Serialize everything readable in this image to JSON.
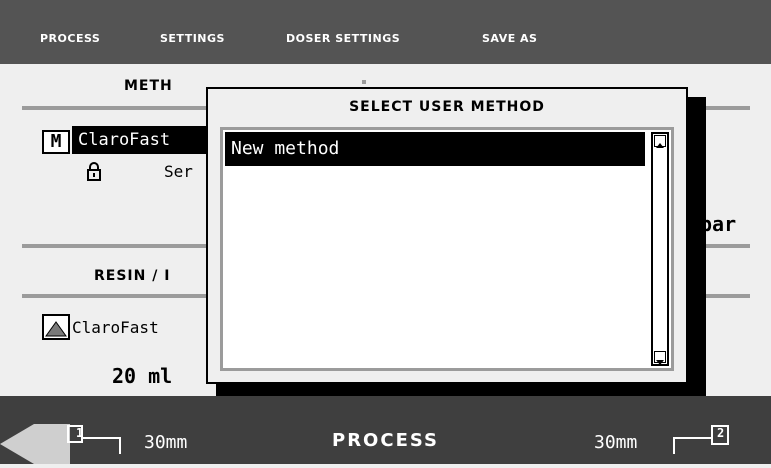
{
  "menu": {
    "process": "PROCESS",
    "settings": "SETTINGS",
    "doser_settings": "DOSER SETTINGS",
    "save_as": "SAVE AS"
  },
  "main": {
    "method_header": "METH",
    "row1_label": "ClaroFast",
    "row1_icon": "M",
    "row2_label": "Ser",
    "pressure": "bar",
    "resin_header": "RESIN / I",
    "resin_label": "ClaroFast",
    "volume": "20 ml"
  },
  "modal": {
    "title": "SELECT USER METHOD",
    "items": [
      "New method"
    ]
  },
  "bottom": {
    "left_badge": "1",
    "left_value": "30mm",
    "center": "PROCESS",
    "right_value": "30mm",
    "right_badge": "2"
  },
  "colors": {
    "topbar": "#545454",
    "bottombar": "#3f3f3f",
    "selection": "#000000",
    "rule": "#9b9b9b"
  }
}
